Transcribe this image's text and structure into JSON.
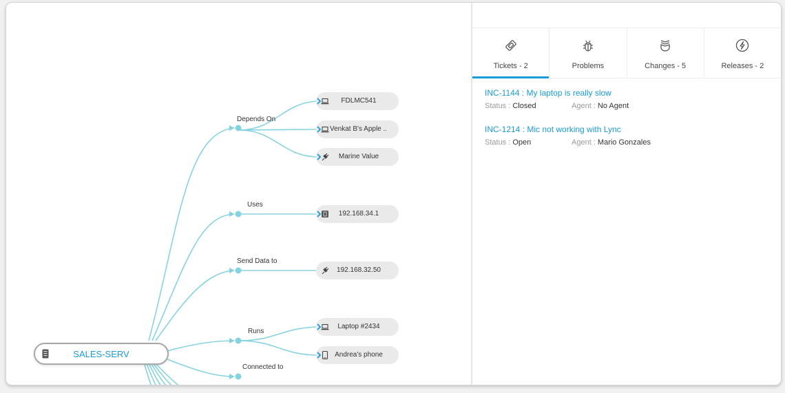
{
  "map": {
    "root": {
      "label": "SALES-SERV",
      "icon": "server-icon"
    },
    "relations": [
      {
        "label": "Depends On",
        "nodes": [
          {
            "label": "FDLMC541",
            "icon": "laptop-icon",
            "has_chevron": true
          },
          {
            "label": "Venkat B's Apple ...",
            "icon": "laptop-icon",
            "has_chevron": true
          },
          {
            "label": "Marine Value",
            "icon": "plug-icon",
            "has_chevron": true
          }
        ]
      },
      {
        "label": "Uses",
        "nodes": [
          {
            "label": "192.168.34.1",
            "icon": "server-icon",
            "has_chevron": true
          }
        ]
      },
      {
        "label": "Send Data to",
        "nodes": [
          {
            "label": "192.168.32.50",
            "icon": "plug-icon",
            "has_chevron": false
          }
        ]
      },
      {
        "label": "Runs",
        "nodes": [
          {
            "label": "Laptop #2434",
            "icon": "laptop-icon",
            "has_chevron": true
          },
          {
            "label": "Andrea's phone",
            "icon": "phone-icon",
            "has_chevron": true
          }
        ]
      },
      {
        "label": "Connected to",
        "nodes": []
      }
    ]
  },
  "panel": {
    "tabs": [
      {
        "label": "Tickets - 2",
        "icon": "ticket-icon",
        "active": true
      },
      {
        "label": "Problems",
        "icon": "bug-icon",
        "active": false
      },
      {
        "label": "Changes - 5",
        "icon": "changes-icon",
        "active": false
      },
      {
        "label": "Releases - 2",
        "icon": "lightning-icon",
        "active": false
      }
    ],
    "status_key": "Status : ",
    "agent_key": "Agent : ",
    "tickets": [
      {
        "title": "INC-1144 : My laptop is really slow",
        "status": "Closed",
        "agent": "No Agent"
      },
      {
        "title": "INC-1214 : Mic not working with Lync",
        "status": "Open",
        "agent": "Mario Gonzales"
      }
    ]
  },
  "colors": {
    "accent": "#1a9ad6",
    "link_line": "#86d3e0",
    "pill_bg": "#eaeaea"
  }
}
